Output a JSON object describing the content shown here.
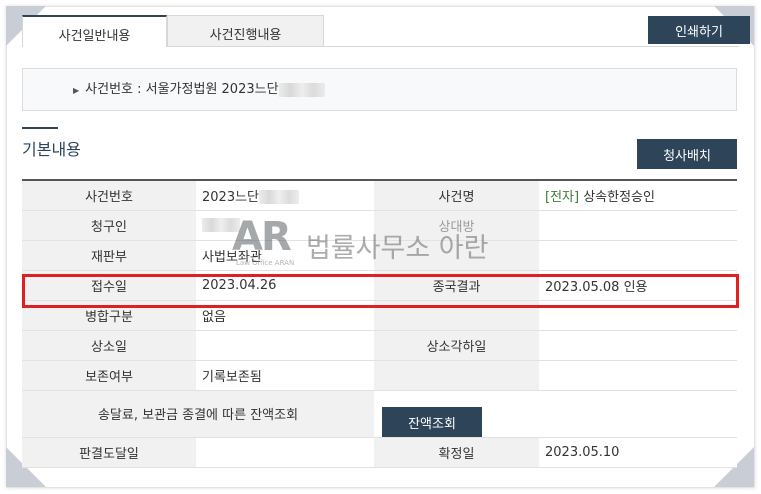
{
  "tabs": [
    {
      "label": "사건일반내용",
      "active": true
    },
    {
      "label": "사건진행내용",
      "active": false
    }
  ],
  "print_button": "인쇄하기",
  "case_box": {
    "label": "사건번호 : 서울가정법원 2023느단"
  },
  "section": {
    "title": "기본내용",
    "court_button": "청사배치"
  },
  "table": {
    "row1": {
      "h1": "사건번호",
      "v1": "2023느단",
      "h2": "사건명",
      "v2_tag": "[전자]",
      "v2": "상속한정승인"
    },
    "row2": {
      "h1": "청구인",
      "v1": "",
      "h2": "상대방",
      "v2": ""
    },
    "row3": {
      "h1": "재판부",
      "v1": "사법보좌관",
      "h2": "",
      "v2": ""
    },
    "row4": {
      "h1": "접수일",
      "v1": "2023.04.26",
      "h2": "종국결과",
      "v2": "2023.05.08 인용"
    },
    "row5": {
      "h1": "병합구분",
      "v1": "없음",
      "h2": "",
      "v2": ""
    },
    "row6": {
      "h1": "상소일",
      "v1": "",
      "h2": "상소각하일",
      "v2": ""
    },
    "row7": {
      "h1": "보존여부",
      "v1": "기록보존됨",
      "h2": "",
      "v2": ""
    },
    "row8": {
      "label": "송달료, 보관금 종결에 따른 잔액조회",
      "button": "잔액조회"
    },
    "row9": {
      "h1": "판결도달일",
      "v1": "",
      "h2": "확정일",
      "v2": "2023.05.10"
    }
  },
  "watermark": {
    "logo": "AR",
    "sub": "Law Office ARAN",
    "text": "법률사무소 아란"
  },
  "colors": {
    "accent": "#2e4459",
    "highlight": "#e02020",
    "header_bg": "#f1f1f1",
    "tag_green": "#3a7c3a"
  }
}
